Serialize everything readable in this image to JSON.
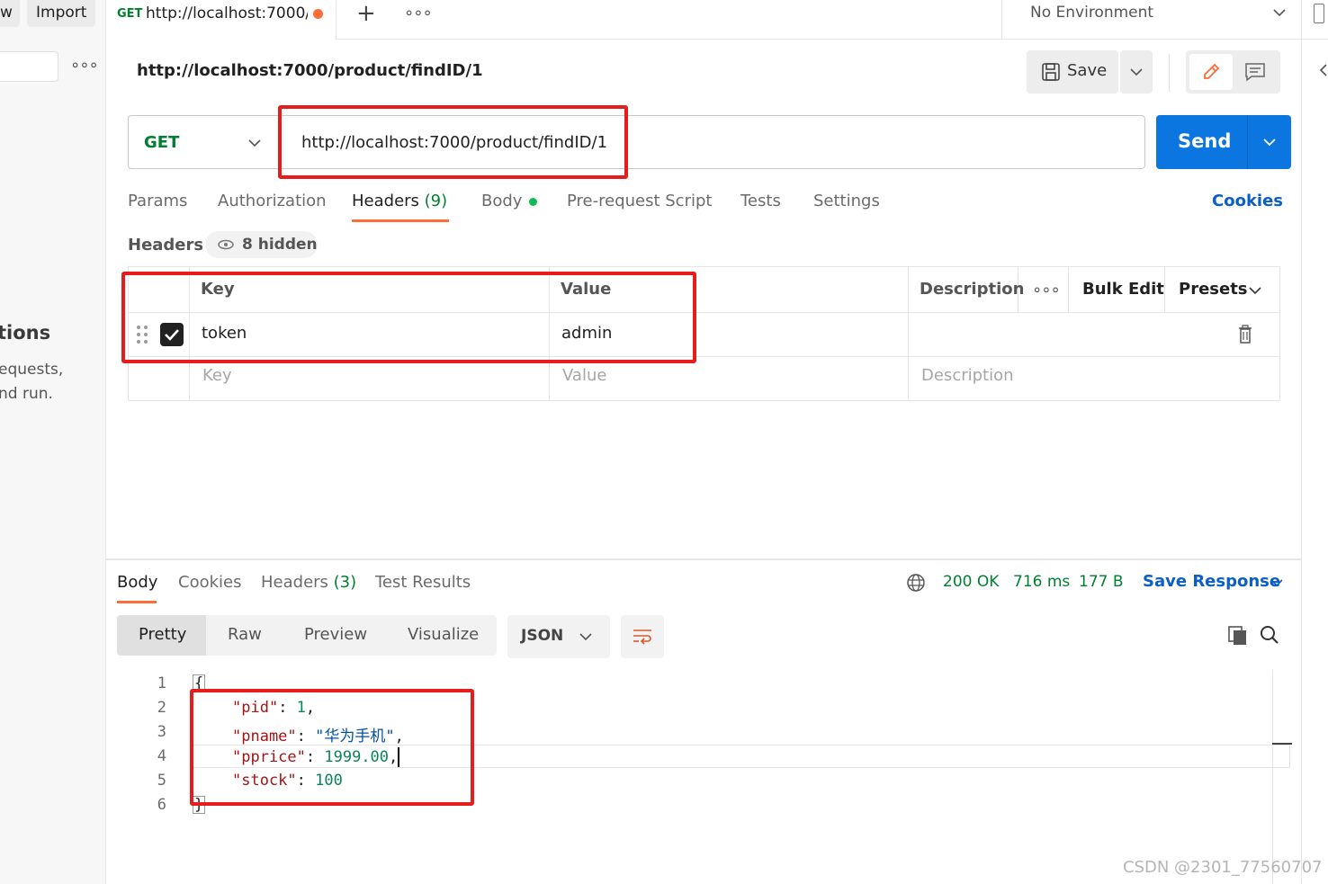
{
  "sidebar": {
    "new_label": "w",
    "import_label": "Import",
    "heading_fragment": "tions",
    "text_line1": "equests,",
    "text_line2": "nd run."
  },
  "tabs": {
    "active_method": "GET",
    "active_title": "http://localhost:7000/p",
    "environment": "No Environment"
  },
  "request": {
    "breadcrumb": "http://localhost:7000/product/findID/1",
    "save_label": "Save",
    "method": "GET",
    "url": "http://localhost:7000/product/findID/1",
    "send_label": "Send",
    "subtabs": [
      {
        "label": "Params"
      },
      {
        "label": "Authorization"
      },
      {
        "label": "Headers",
        "count": "(9)"
      },
      {
        "label": "Body"
      },
      {
        "label": "Pre-request Script"
      },
      {
        "label": "Tests"
      },
      {
        "label": "Settings"
      }
    ],
    "cookies_label": "Cookies",
    "headers_title": "Headers",
    "hidden_label": "8 hidden",
    "table": {
      "col_key": "Key",
      "col_value": "Value",
      "col_description": "Description",
      "bulk_edit": "Bulk Edit",
      "presets": "Presets",
      "rows": [
        {
          "key": "token",
          "value": "admin",
          "checked": true
        }
      ],
      "placeholder_key": "Key",
      "placeholder_value": "Value",
      "placeholder_description": "Description"
    }
  },
  "response": {
    "tabs": [
      {
        "label": "Body"
      },
      {
        "label": "Cookies"
      },
      {
        "label": "Headers",
        "count": "(3)"
      },
      {
        "label": "Test Results"
      }
    ],
    "status": "200 OK",
    "time": "716 ms",
    "size": "177 B",
    "save_response": "Save Response",
    "view_modes": [
      "Pretty",
      "Raw",
      "Preview",
      "Visualize"
    ],
    "format": "JSON",
    "lines": [
      "1",
      "2",
      "3",
      "4",
      "5",
      "6"
    ],
    "json": {
      "open": "{",
      "close": "}",
      "pid_key": "\"pid\"",
      "pid_val": "1",
      "pname_key": "\"pname\"",
      "pname_val": "\"华为手机\"",
      "pprice_key": "\"pprice\"",
      "pprice_val": "1999.00",
      "stock_key": "\"stock\"",
      "stock_val": "100"
    }
  },
  "watermark": "CSDN @2301_77560707",
  "colors": {
    "accent_orange": "#ff6c37",
    "send_blue": "#0b76e0",
    "link_blue": "#0b5fc6",
    "status_green": "#007f31",
    "get_green": "#007f31",
    "annotation_red": "#e61d1d"
  }
}
